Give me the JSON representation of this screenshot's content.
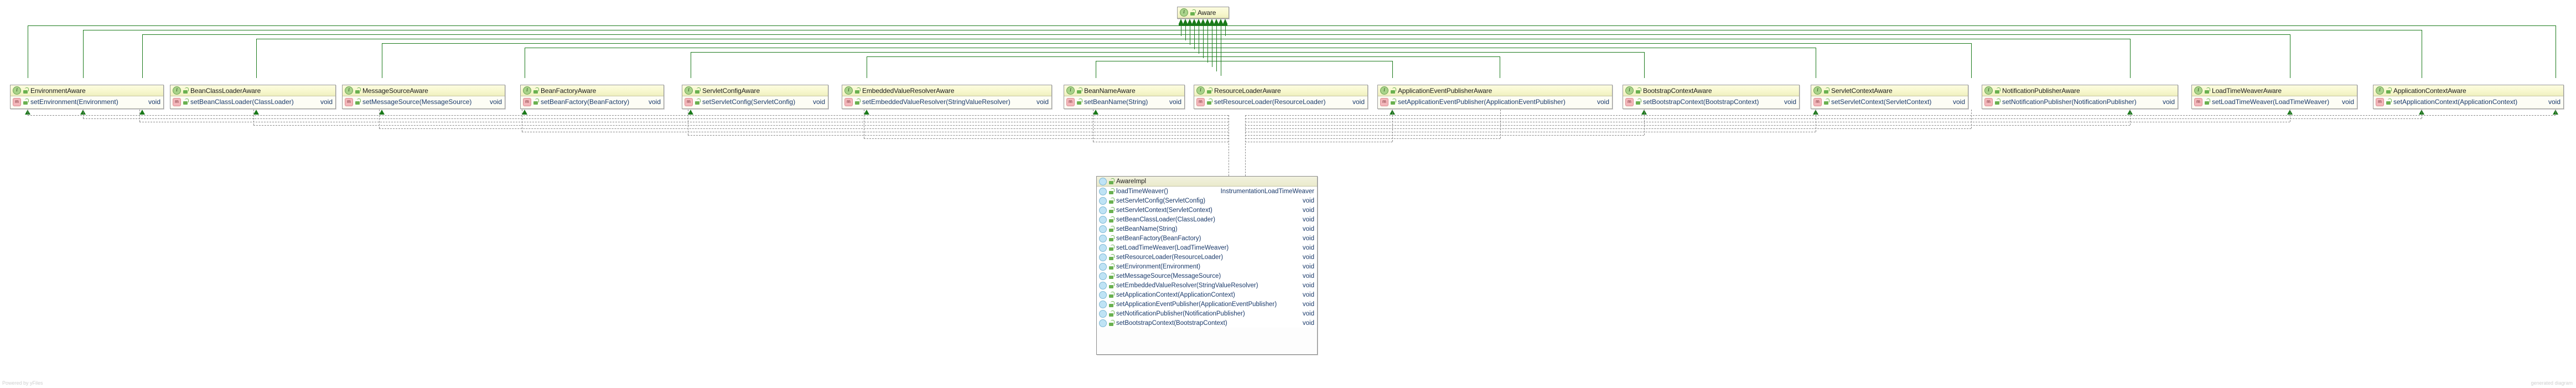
{
  "diagram": {
    "type": "uml-class-diagram",
    "root": {
      "name": "Aware",
      "stereotype": "interface",
      "icon": "interface-icon",
      "members": []
    },
    "interfaces": [
      {
        "name": "EnvironmentAware",
        "method": "setEnvironment(Environment)",
        "return": "void"
      },
      {
        "name": "BeanClassLoaderAware",
        "method": "setBeanClassLoader(ClassLoader)",
        "return": "void"
      },
      {
        "name": "MessageSourceAware",
        "method": "setMessageSource(MessageSource)",
        "return": "void"
      },
      {
        "name": "BeanFactoryAware",
        "method": "setBeanFactory(BeanFactory)",
        "return": "void"
      },
      {
        "name": "ServletConfigAware",
        "method": "setServletConfig(ServletConfig)",
        "return": "void"
      },
      {
        "name": "EmbeddedValueResolverAware",
        "method": "setEmbeddedValueResolver(StringValueResolver)",
        "return": "void"
      },
      {
        "name": "BeanNameAware",
        "method": "setBeanName(String)",
        "return": "void"
      },
      {
        "name": "ResourceLoaderAware",
        "method": "setResourceLoader(ResourceLoader)",
        "return": "void"
      },
      {
        "name": "ApplicationEventPublisherAware",
        "method": "setApplicationEventPublisher(ApplicationEventPublisher)",
        "return": "void"
      },
      {
        "name": "BootstrapContextAware",
        "method": "setBootstrapContext(BootstrapContext)",
        "return": "void"
      },
      {
        "name": "ServletContextAware",
        "method": "setServletContext(ServletContext)",
        "return": "void"
      },
      {
        "name": "NotificationPublisherAware",
        "method": "setNotificationPublisher(NotificationPublisher)",
        "return": "void"
      },
      {
        "name": "LoadTimeWeaverAware",
        "method": "setLoadTimeWeaver(LoadTimeWeaver)",
        "return": "void"
      },
      {
        "name": "ApplicationContextAware",
        "method": "setApplicationContext(ApplicationContext)",
        "return": "void"
      }
    ],
    "implementation": {
      "name": "AwareImpl",
      "methods": [
        {
          "sig": "loadTimeWeaver()",
          "ret": "InstrumentationLoadTimeWeaver"
        },
        {
          "sig": "setServletConfig(ServletConfig)",
          "ret": "void"
        },
        {
          "sig": "setServletContext(ServletContext)",
          "ret": "void"
        },
        {
          "sig": "setBeanClassLoader(ClassLoader)",
          "ret": "void"
        },
        {
          "sig": "setBeanName(String)",
          "ret": "void"
        },
        {
          "sig": "setBeanFactory(BeanFactory)",
          "ret": "void"
        },
        {
          "sig": "setLoadTimeWeaver(LoadTimeWeaver)",
          "ret": "void"
        },
        {
          "sig": "setResourceLoader(ResourceLoader)",
          "ret": "void"
        },
        {
          "sig": "setEnvironment(Environment)",
          "ret": "void"
        },
        {
          "sig": "setMessageSource(MessageSource)",
          "ret": "void"
        },
        {
          "sig": "setEmbeddedValueResolver(StringValueResolver)",
          "ret": "void"
        },
        {
          "sig": "setApplicationContext(ApplicationContext)",
          "ret": "void"
        },
        {
          "sig": "setApplicationEventPublisher(ApplicationEventPublisher)",
          "ret": "void"
        },
        {
          "sig": "setNotificationPublisher(NotificationPublisher)",
          "ret": "void"
        },
        {
          "sig": "setBootstrapContext(BootstrapContext)",
          "ret": "void"
        }
      ]
    },
    "icons": {
      "interface_glyph": "I",
      "method_glyph": "m"
    },
    "colors": {
      "connector": "#1a7a1a",
      "interface_header": "#f7f7cd",
      "class_header": "#eaeacc",
      "member_text": "#1a3a6b"
    },
    "watermark_left": "Powered by yFiles",
    "watermark_right": "generated diagram"
  }
}
